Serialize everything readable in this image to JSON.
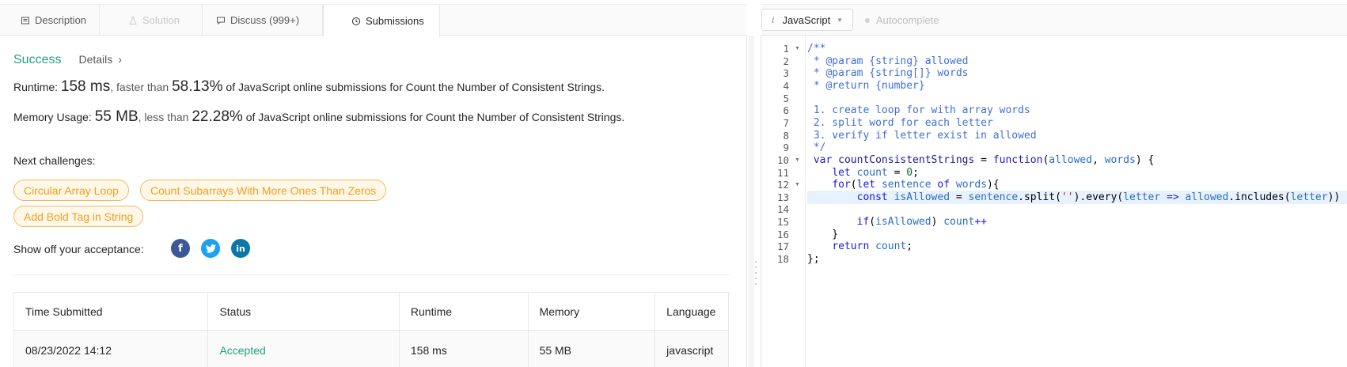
{
  "tabs": [
    {
      "label": "Description",
      "icon": "document-icon",
      "state": "normal"
    },
    {
      "label": "Solution",
      "icon": "flask-icon",
      "state": "disabled"
    },
    {
      "label": "Discuss (999+)",
      "icon": "chat-icon",
      "state": "normal"
    },
    {
      "label": "Submissions",
      "icon": "clock-icon",
      "state": "active"
    }
  ],
  "result": {
    "status": "Success",
    "details_label": "Details",
    "runtime_label": "Runtime:",
    "runtime_value": "158 ms",
    "runtime_mid": ", faster than",
    "runtime_pct": "58.13%",
    "runtime_tail": "of JavaScript online submissions for Count the Number of Consistent Strings.",
    "memory_label": "Memory Usage:",
    "memory_value": "55 MB",
    "memory_mid": ", less than",
    "memory_pct": "22.28%",
    "memory_tail": "of JavaScript online submissions for Count the Number of Consistent Strings."
  },
  "next_challenges": {
    "label": "Next challenges:",
    "items": [
      "Circular Array Loop",
      "Count Subarrays With More Ones Than Zeros",
      "Add Bold Tag in String"
    ]
  },
  "share": {
    "label": "Show off your acceptance:",
    "icons": [
      "facebook-icon",
      "twitter-icon",
      "linkedin-icon"
    ],
    "colors": {
      "facebook": "#3b5998",
      "twitter": "#1da1f2",
      "linkedin": "#0e76a8"
    }
  },
  "submissions_table": {
    "columns": [
      "Time Submitted",
      "Status",
      "Runtime",
      "Memory",
      "Language"
    ],
    "rows": [
      {
        "time": "08/23/2022 14:12",
        "status": "Accepted",
        "runtime": "158 ms",
        "memory": "55 MB",
        "language": "javascript"
      }
    ]
  },
  "editor": {
    "language": "JavaScript",
    "autocomplete_label": "Autocomplete",
    "line_numbers": [
      "1",
      "2",
      "3",
      "4",
      "5",
      "6",
      "7",
      "8",
      "9",
      "10",
      "11",
      "12",
      "13",
      "14",
      "15",
      "16",
      "17",
      "18"
    ],
    "code_lines": [
      "/**",
      " * @param {string} allowed",
      " * @param {string[]} words",
      " * @return {number}",
      "",
      " 1. create loop for with array words",
      " 2. split word for each letter",
      " 3. verify if letter exist in allowed",
      " */",
      " var countConsistentStrings = function(allowed, words) {",
      "    let count = 0;",
      "    for(let sentence of words){",
      "        const isAllowed = sentence.split('').every(letter => allowed.includes(letter))",
      "",
      "        if(isAllowed) count++",
      "    }",
      "    return count;",
      "};"
    ]
  },
  "colors": {
    "accent_green": "#1fa37f",
    "chip_orange": "#f0a020",
    "comment_blue": "#3f6fd8"
  }
}
